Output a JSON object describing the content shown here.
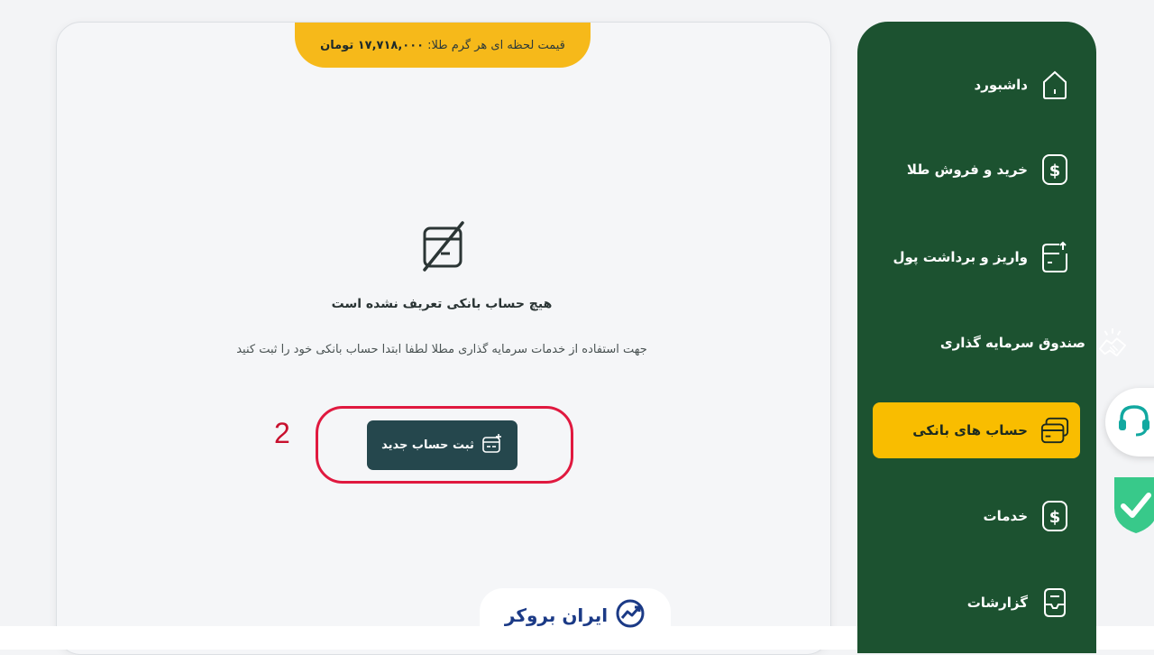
{
  "banner": {
    "label": "قیمت لحظه ای هر گرم طلا:",
    "price": "۱۷,۷۱۸,۰۰۰ تومان"
  },
  "empty_state": {
    "title": "هیچ حساب بانکی تعریف نشده است",
    "description": "جهت استفاده از خدمات سرمایه گذاری مطلا لطفا ابتدا حساب بانکی خود را ثبت کنید",
    "button_label": "ثبت حساب جدید"
  },
  "annotation": {
    "step_number": "2"
  },
  "brand": {
    "logo_text": "ایران بروکر"
  },
  "sidebar": {
    "items": [
      {
        "label": "داشبورد",
        "icon": "home-icon"
      },
      {
        "label": "خرید و فروش طلا",
        "icon": "dollar-icon"
      },
      {
        "label": "واریز و برداشت پول",
        "icon": "deposit-icon"
      },
      {
        "label": "صندوق سرمایه گذاری",
        "icon": "handshake-icon"
      },
      {
        "label": "حساب های بانکی",
        "icon": "card-icon",
        "active": true
      },
      {
        "label": "خدمات",
        "icon": "dollar-icon"
      },
      {
        "label": "گزارشات",
        "icon": "report-icon"
      }
    ]
  },
  "colors": {
    "sidebar": "#1c5230",
    "active": "#f9bd00",
    "banner": "#f6b91a",
    "button": "#25474d",
    "highlight": "#e0193f"
  }
}
